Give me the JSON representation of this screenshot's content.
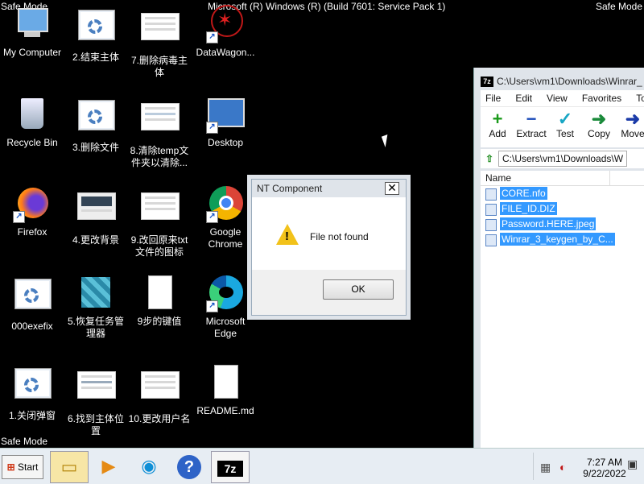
{
  "top_bar": {
    "safe_mode_left": "Safe Mode",
    "safe_mode_right": "Safe Mode",
    "build_info": "Microsoft (R) Windows (R) (Build 7601: Service Pack 1)",
    "safe_mode_bottom": "Safe Mode"
  },
  "desktop_icons": [
    {
      "label": "My Computer"
    },
    {
      "label": "2.结束主体"
    },
    {
      "label": "7.删除病毒主\n体"
    },
    {
      "label": "DataWagon..."
    },
    {
      "label": "Recycle Bin"
    },
    {
      "label": "3.删除文件"
    },
    {
      "label": "8.清除temp文\n件夹以清除..."
    },
    {
      "label": "Desktop"
    },
    {
      "label": "Firefox"
    },
    {
      "label": "4.更改背景"
    },
    {
      "label": "9.改回原来txt\n文件的图标"
    },
    {
      "label": "Google\nChrome"
    },
    {
      "label": "000exefix"
    },
    {
      "label": "5.恢复任务管\n理器"
    },
    {
      "label": "9步的键值"
    },
    {
      "label": "Microsoft\nEdge"
    },
    {
      "label": "1.关闭弹窗"
    },
    {
      "label": "6.找到主体位\n置"
    },
    {
      "label": "10.更改用户名"
    },
    {
      "label": "README.md"
    }
  ],
  "dialog": {
    "title": "NT Component",
    "close_glyph": "✕",
    "message": "File not found",
    "ok_label": "OK",
    "icon": "warning-icon"
  },
  "sevenzip": {
    "title": "C:\\Users\\vm1\\Downloads\\Winrar_",
    "logo_text": "7z",
    "menu": [
      "File",
      "Edit",
      "View",
      "Favorites",
      "Tools"
    ],
    "toolbar": [
      {
        "label": "Add",
        "glyph": "+",
        "color": "#1a9a1a"
      },
      {
        "label": "Extract",
        "glyph": "−",
        "color": "#1a4ab8"
      },
      {
        "label": "Test",
        "glyph": "✓",
        "color": "#18a6c4"
      },
      {
        "label": "Copy",
        "glyph": "➜",
        "color": "#1a8a3a"
      },
      {
        "label": "Move",
        "glyph": "➜",
        "color": "#1a3aa8"
      }
    ],
    "path": "C:\\Users\\vm1\\Downloads\\W",
    "column_name": "Name",
    "files": [
      {
        "name": "CORE.nfo"
      },
      {
        "name": "FILE_ID.DIZ"
      },
      {
        "name": "Password.HERE.jpeg"
      },
      {
        "name": "Winrar_3_keygen_by_C..."
      }
    ]
  },
  "taskbar": {
    "start_label": "Start",
    "clock_time": "7:27 AM",
    "clock_date": "9/22/2022",
    "active_app": "7z"
  }
}
